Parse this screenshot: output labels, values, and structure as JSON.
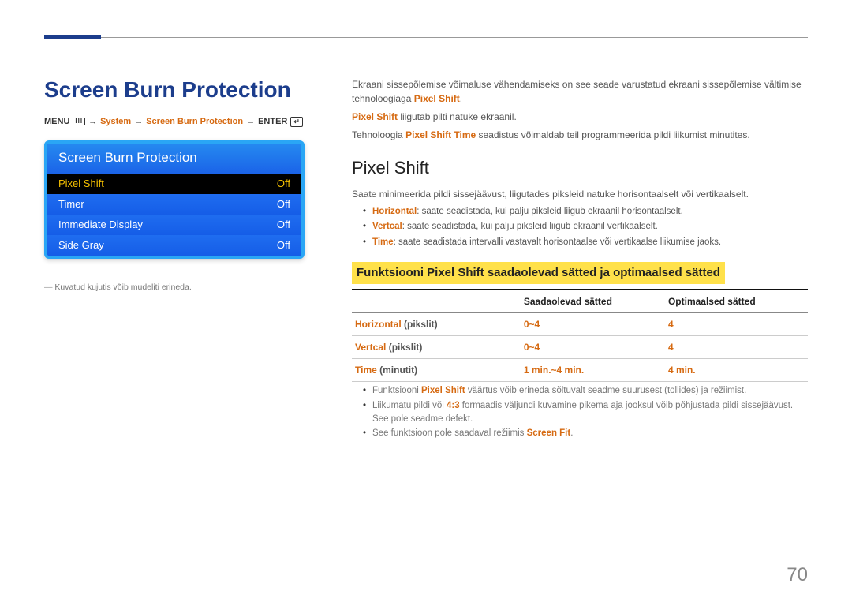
{
  "page_title": "Screen Burn Protection",
  "breadcrumb": {
    "menu": "MENU",
    "system": "System",
    "sbp": "Screen Burn Protection",
    "enter": "ENTER",
    "arrow": "→"
  },
  "osd": {
    "title": "Screen Burn Protection",
    "rows": [
      {
        "label": "Pixel Shift",
        "value": "Off",
        "selected": true
      },
      {
        "label": "Timer",
        "value": "Off",
        "selected": false
      },
      {
        "label": "Immediate Display",
        "value": "Off",
        "selected": false
      },
      {
        "label": "Side Gray",
        "value": "Off",
        "selected": false
      }
    ],
    "note": "Kuvatud kujutis võib mudeliti erineda."
  },
  "intro": {
    "p1a": "Ekraani sissepõlemise võimaluse vähendamiseks on see seade varustatud ekraani sissepõlemise vältimise tehnoloogiaga ",
    "p1b_term": "Pixel Shift",
    "p1c": ".",
    "p2a_term": "Pixel Shift",
    "p2b": " liigutab pilti natuke ekraanil.",
    "p3a": "Tehnoloogia ",
    "p3b_term": "Pixel Shift Time",
    "p3c": " seadistus võimaldab teil programmeerida pildi liikumist minutites."
  },
  "section": {
    "heading": "Pixel Shift",
    "lead": "Saate minimeerida pildi sissejäävust, liigutades piksleid natuke horisontaalselt või vertikaalselt.",
    "bullets": [
      {
        "term": "Horizontal",
        "text": ": saate seadistada, kui palju piksleid liigub ekraanil horisontaalselt."
      },
      {
        "term": "Vertcal",
        "text": ": saate seadistada, kui palju piksleid liigub ekraanil vertikaalselt."
      },
      {
        "term": "Time",
        "text": ": saate seadistada intervalli vastavalt horisontaalse või vertikaalse liikumise jaoks."
      }
    ],
    "sub_heading": "Funktsiooni Pixel Shift saadaolevad sätted ja optimaalsed sätted"
  },
  "table": {
    "col1": "",
    "col2": "Saadaolevad sätted",
    "col3": "Optimaalsed sätted",
    "rows": [
      {
        "label_term": "Horizontal",
        "label_unit": " (pikslit)",
        "avail": "0~4",
        "opt": "4",
        "opt_orange": true
      },
      {
        "label_term": "Vertcal",
        "label_unit": " (pikslit)",
        "avail": "0~4",
        "opt": "4",
        "opt_orange": true
      },
      {
        "label_term": "Time",
        "label_unit": " (minutit)",
        "avail": "1 min.~4 min.",
        "opt": "4 min.",
        "opt_orange": true
      }
    ]
  },
  "footnotes": {
    "f1a": "Funktsiooni ",
    "f1_term": "Pixel Shift",
    "f1b": " väärtus võib erineda sõltuvalt seadme suurusest (tollides) ja režiimist.",
    "f2a": "Liikumatu pildi või ",
    "f2_term": "4:3",
    "f2b": " formaadis väljundi kuvamine pikema aja jooksul võib põhjustada pildi sissejäävust. See pole seadme defekt.",
    "f3a": "See funktsioon pole saadaval režiimis ",
    "f3_term": "Screen Fit",
    "f3b": "."
  },
  "page_number": "70"
}
